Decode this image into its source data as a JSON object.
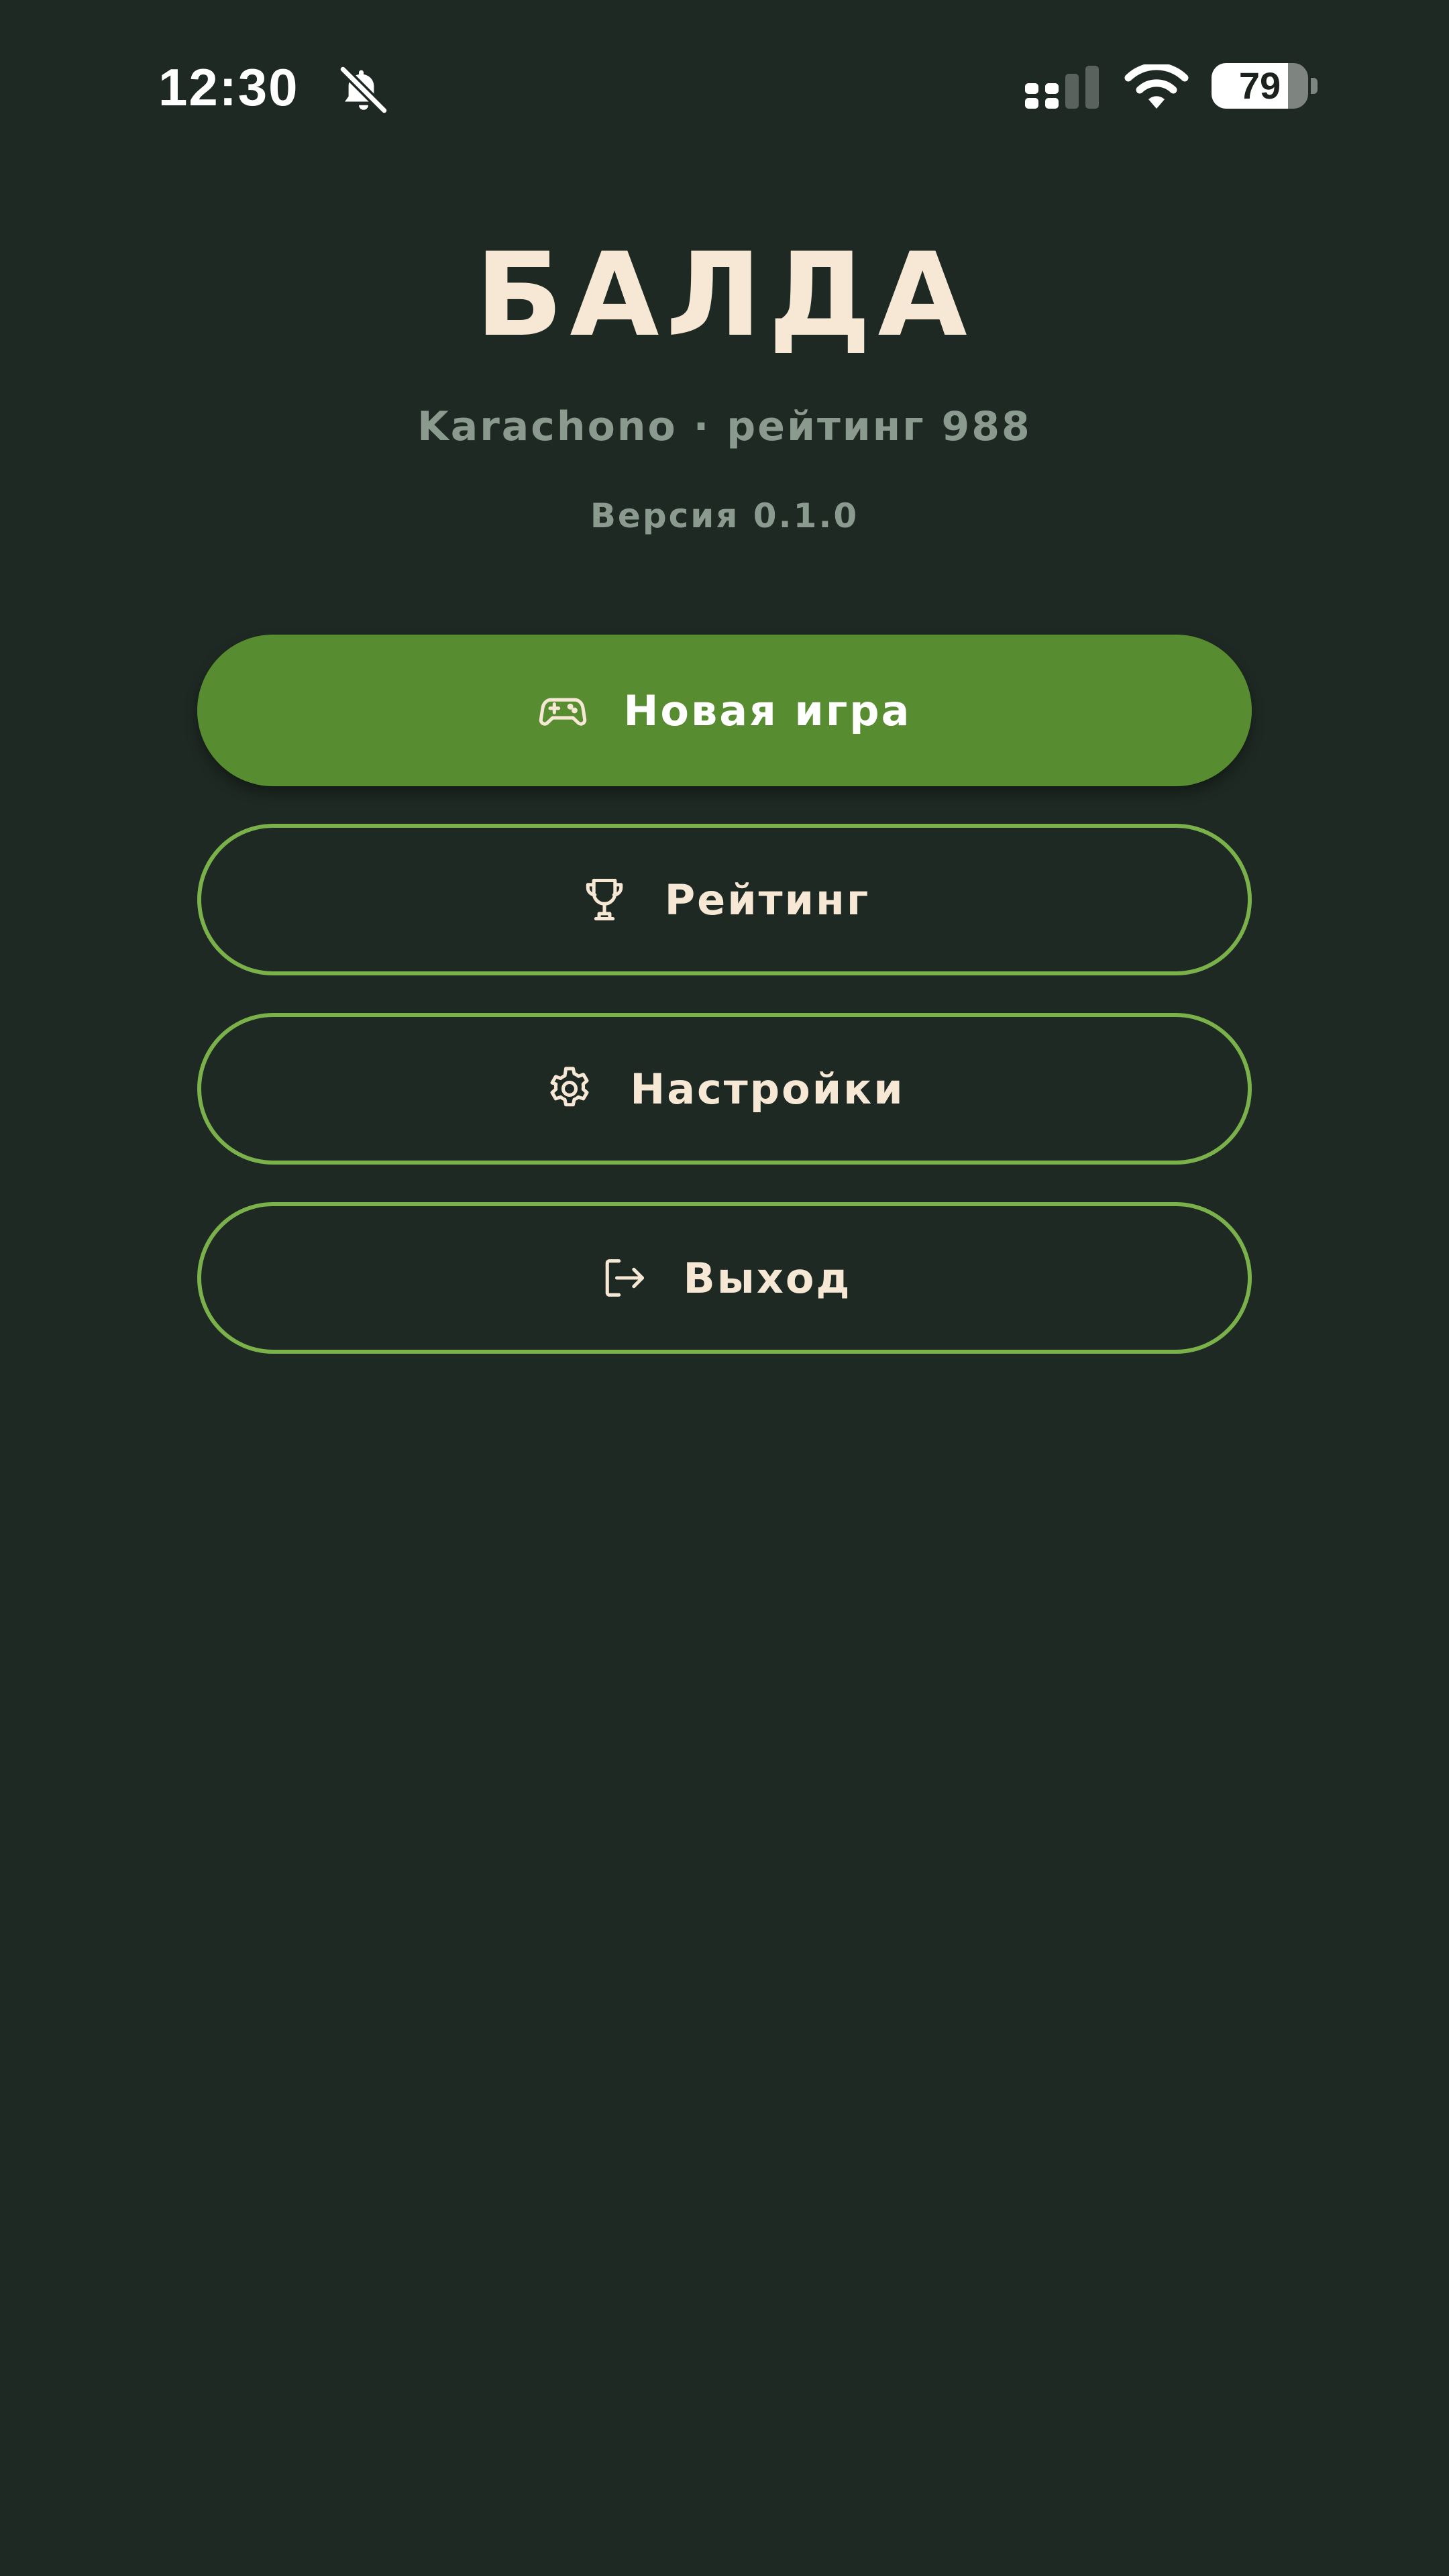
{
  "status_bar": {
    "time": "12:30",
    "battery_level": "79",
    "battery_percent": 79,
    "icons": [
      "bell-off-icon",
      "cellular-icon",
      "wifi-icon",
      "battery-icon"
    ]
  },
  "header": {
    "title": "БАЛДА",
    "player_info": "Karachono · рейтинг 988",
    "version": "Версия 0.1.0"
  },
  "menu": {
    "items": [
      {
        "label": "Новая игра",
        "icon": "gamepad-icon",
        "style": "primary"
      },
      {
        "label": "Рейтинг",
        "icon": "trophy-icon",
        "style": "outline"
      },
      {
        "label": "Настройки",
        "icon": "gear-icon",
        "style": "outline"
      },
      {
        "label": "Выход",
        "icon": "logout-icon",
        "style": "outline"
      }
    ]
  },
  "colors": {
    "background": "#1e2923",
    "primary_button": "#578c30",
    "outline_border": "#7bb14a",
    "title_text": "#f6e8d4",
    "muted_text": "#8b9a8e"
  }
}
